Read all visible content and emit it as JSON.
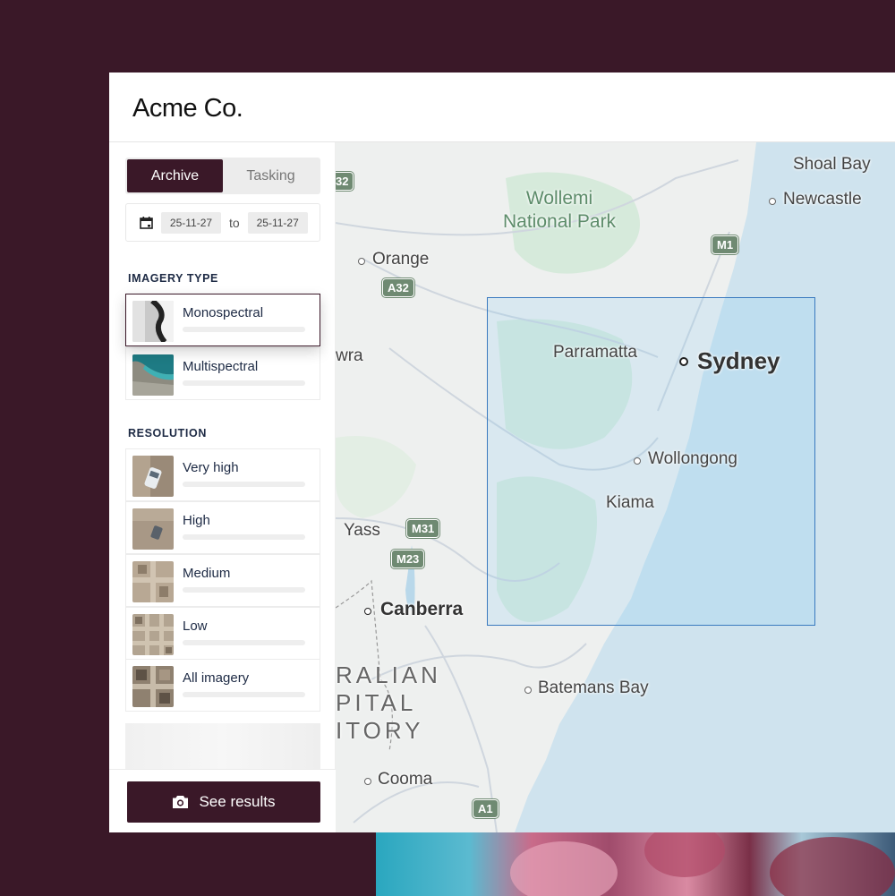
{
  "app": {
    "logo": "Acme Co."
  },
  "sidebar": {
    "tabs": [
      {
        "label": "Archive",
        "active": true
      },
      {
        "label": "Tasking",
        "active": false
      }
    ],
    "dates": {
      "start": "25-11-27",
      "separator": "to",
      "end": "25-11-27"
    },
    "imagery_type": {
      "heading": "IMAGERY TYPE",
      "options": [
        {
          "label": "Monospectral",
          "selected": true
        },
        {
          "label": "Multispectral",
          "selected": false
        }
      ]
    },
    "resolution": {
      "heading": "RESOLUTION",
      "options": [
        {
          "label": "Very high"
        },
        {
          "label": "High"
        },
        {
          "label": "Medium"
        },
        {
          "label": "Low"
        },
        {
          "label": "All imagery"
        }
      ]
    },
    "cta": {
      "label": "See results",
      "icon": "camera-icon"
    }
  },
  "map": {
    "places": {
      "shoal_bay": "Shoal Bay",
      "newcastle": "Newcastle",
      "wollemi_1": "Wollemi",
      "wollemi_2": "National Park",
      "orange": "Orange",
      "cowra": "wra",
      "parramatta": "Parramatta",
      "sydney": "Sydney",
      "wollongong": "Wollongong",
      "kiama": "Kiama",
      "yass": "Yass",
      "canberra": "Canberra",
      "territory_1": "RALIAN",
      "territory_2": "PITAL",
      "territory_3": "ITORY",
      "batemans_bay": "Batemans Bay",
      "cooma": "Cooma"
    },
    "shields": {
      "a32_top": "32",
      "a32": "A32",
      "m1": "M1",
      "m31": "M31",
      "m23": "M23",
      "a1": "A1"
    },
    "colors": {
      "ocean": "#cfe3ee",
      "land": "#eef0ef",
      "park": "#d6eadb",
      "selection": "#3a7abf",
      "brand": "#3a1828"
    }
  }
}
